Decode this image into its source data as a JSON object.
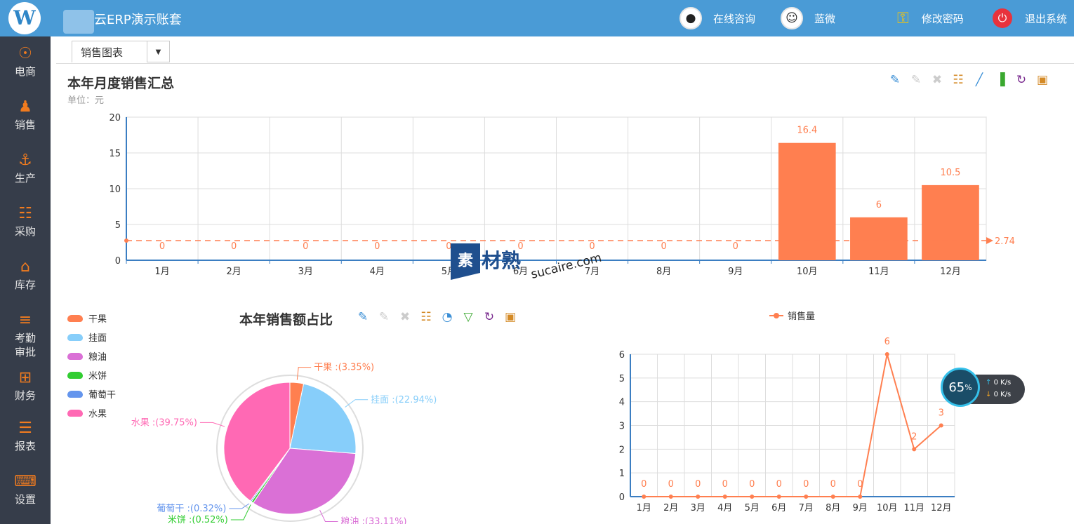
{
  "header": {
    "app_title": "云ERP演示账套",
    "logo_text": "W",
    "consult_label": "在线咨询",
    "user_name": "蓝微",
    "change_password_label": "修改密码",
    "logout_label": "退出系统"
  },
  "sidebar": {
    "items": [
      {
        "label": "电商",
        "icon": "compass-icon"
      },
      {
        "label": "销售",
        "icon": "salesperson-icon"
      },
      {
        "label": "生产",
        "icon": "production-icon"
      },
      {
        "label": "采购",
        "icon": "cart-icon"
      },
      {
        "label": "库存",
        "icon": "home-icon"
      },
      {
        "label": "考勤",
        "label2": "审批",
        "icon": "attendance-icon"
      },
      {
        "label": "财务",
        "icon": "finance-icon"
      },
      {
        "label": "报表",
        "icon": "report-icon"
      },
      {
        "label": "设置",
        "icon": "keyboard-icon"
      }
    ]
  },
  "tabs": {
    "active": "销售图表"
  },
  "monthly": {
    "title": "本年月度销售汇总",
    "unit": "单位：元"
  },
  "ratio": {
    "title": "本年销售额占比"
  },
  "colors": {
    "accent": "#ff7f50",
    "header": "#4a9bd6",
    "sidebar": "#363d4a"
  },
  "watermark": {
    "brand": "素材熟",
    "url": "sucaire.com"
  },
  "net_widget": {
    "percent": "65",
    "percent_unit": "%",
    "up": "0 K/s",
    "down": "0 K/s"
  },
  "chart_data": [
    {
      "type": "bar",
      "categories": [
        "1月",
        "2月",
        "3月",
        "4月",
        "5月",
        "6月",
        "7月",
        "8月",
        "9月",
        "10月",
        "11月",
        "12月"
      ],
      "values": [
        0,
        0,
        0,
        0,
        0,
        0,
        0,
        0,
        0,
        16.4,
        6,
        10.5
      ],
      "ylim": [
        0,
        20
      ],
      "yticks": [
        0,
        5,
        10,
        15,
        20
      ],
      "average_line": 2.74,
      "average_label": "2.74",
      "color": "#ff7f50",
      "grid": true
    },
    {
      "type": "pie",
      "slices": [
        {
          "name": "干果",
          "percent": 3.35,
          "label": "干果 :(3.35%)",
          "color": "#ff7f50"
        },
        {
          "name": "挂面",
          "percent": 22.94,
          "label": "挂面 :(22.94%)",
          "color": "#87cefa"
        },
        {
          "name": "粮油",
          "percent": 33.11,
          "label": "粮油 :(33.11%)",
          "color": "#da70d6"
        },
        {
          "name": "米饼",
          "percent": 0.52,
          "label": "米饼 :(0.52%)",
          "color": "#32cd32"
        },
        {
          "name": "葡萄干",
          "percent": 0.32,
          "label": "葡萄干 :(0.32%)",
          "color": "#6495ed"
        },
        {
          "name": "水果",
          "percent": 39.75,
          "label": "水果 :(39.75%)",
          "color": "#ff69b4"
        }
      ],
      "legend_position": "left"
    },
    {
      "type": "line",
      "categories": [
        "1月",
        "2月",
        "3月",
        "4月",
        "5月",
        "6月",
        "7月",
        "8月",
        "9月",
        "10月",
        "11月",
        "12月"
      ],
      "series": [
        {
          "name": "销售量",
          "values": [
            0,
            0,
            0,
            0,
            0,
            0,
            0,
            0,
            0,
            6,
            2,
            3
          ]
        }
      ],
      "ylim": [
        0,
        6
      ],
      "yticks": [
        0,
        1,
        2,
        3,
        4,
        5,
        6
      ],
      "color": "#ff7f50",
      "legend_position": "top",
      "grid": true
    }
  ]
}
